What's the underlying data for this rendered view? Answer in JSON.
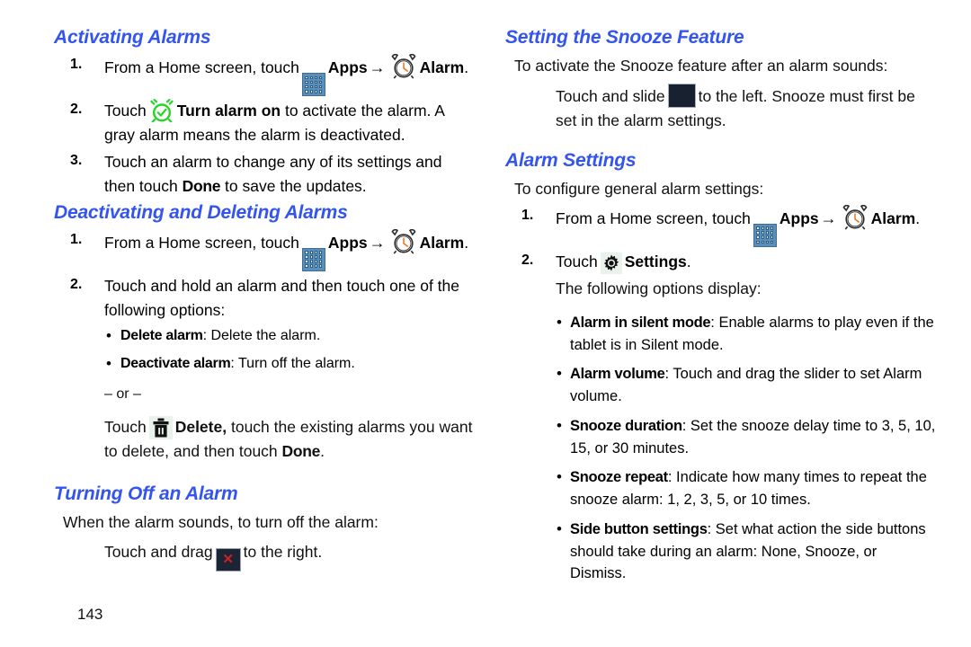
{
  "page": {
    "number": "143",
    "heading_color": "#3355ee",
    "background": "#ffffff"
  },
  "icons": {
    "apps": "apps-grid-icon",
    "alarm_clock": "alarm-clock-icon",
    "green_alarm": "green-alarm-check-icon",
    "trash": "trash-can-icon",
    "close_x": "red-x-button-icon",
    "snooze_square": "dark-snooze-button-icon",
    "gear": "gear-settings-icon",
    "arrow": "→",
    "bullet": "•"
  },
  "left_column": {
    "section1": {
      "heading": "Activating Alarms",
      "steps": [
        {
          "num": "1.",
          "pre": "From a Home screen, touch",
          "apps_label": "Apps",
          "alarm_label": "Alarm",
          "post": "."
        },
        {
          "num": "2.",
          "pre": "Touch",
          "bold": "Turn alarm on",
          "post": "to activate the alarm. A gray alarm means the alarm is deactivated."
        },
        {
          "num": "3.",
          "pre": "Touch an alarm to change any of its settings and then touch",
          "bold": "Done",
          "post": "to save the updates."
        }
      ]
    },
    "section2": {
      "heading": "Deactivating and Deleting Alarms",
      "steps": [
        {
          "num": "1.",
          "pre": "From a Home screen, touch",
          "apps_label": "Apps",
          "alarm_label": "Alarm",
          "post": "."
        },
        {
          "num": "2.",
          "text": "Touch and hold an alarm and then touch one of the following options:"
        }
      ],
      "bullets": [
        {
          "bold": "Delete alarm",
          "rest": ": Delete the alarm."
        },
        {
          "bold": "Deactivate alarm",
          "rest": ": Turn off the alarm."
        }
      ],
      "or_text": "– or –",
      "delete_para": {
        "pre": "Touch",
        "bold": "Delete,",
        "mid": "touch the existing alarms you want to delete, and then touch",
        "bold2": "Done",
        "post": "."
      }
    },
    "section3": {
      "heading": "Turning Off an Alarm",
      "intro": "When the alarm sounds, to turn off the alarm:",
      "action": {
        "pre": "Touch and drag",
        "post": "to the right."
      }
    }
  },
  "right_column": {
    "section1": {
      "heading": "Setting the Snooze Feature",
      "intro": "To activate the Snooze feature after an alarm sounds:",
      "action": {
        "pre": "Touch and slide",
        "post": "to the left. Snooze must first be set in the alarm settings."
      }
    },
    "section2": {
      "heading": "Alarm Settings",
      "intro": "To configure general alarm settings:",
      "steps": [
        {
          "num": "1.",
          "pre": "From a Home screen, touch",
          "apps_label": "Apps",
          "alarm_label": "Alarm",
          "post": "."
        },
        {
          "num": "2.",
          "pre": "Touch",
          "bold": "Settings",
          "post": "."
        }
      ],
      "options_intro": "The following options display:",
      "options": [
        {
          "bold": "Alarm in silent mode",
          "rest": ": Enable alarms to play even if the tablet is in Silent mode."
        },
        {
          "bold": "Alarm volume",
          "rest": ": Touch and drag the slider to set Alarm volume."
        },
        {
          "bold": "Snooze duration",
          "rest": ": Set the snooze delay time to 3, 5, 10, 15, or 30 minutes."
        },
        {
          "bold": "Snooze repeat",
          "rest": ": Indicate how many times to repeat the snooze alarm: 1, 2, 3, 5, or 10 times."
        },
        {
          "bold": "Side button settings",
          "rest": ": Set what action the side buttons should take during an alarm: None, Snooze, or Dismiss."
        }
      ]
    }
  }
}
